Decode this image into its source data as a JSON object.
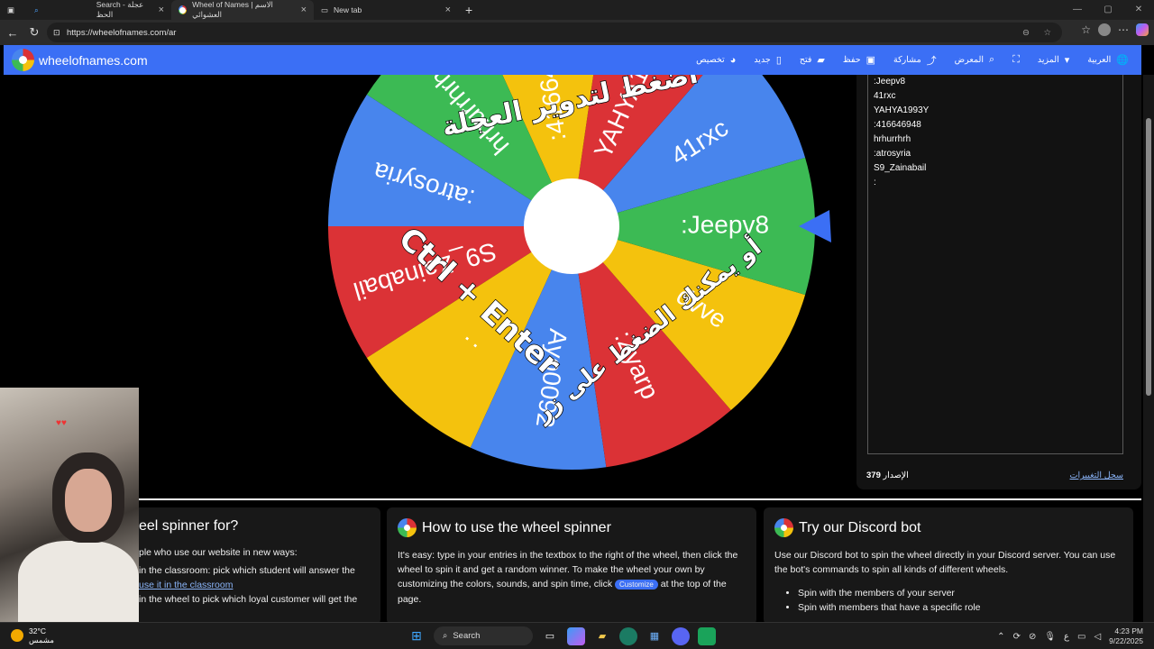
{
  "browser": {
    "tabs": [
      {
        "label": "Search - عجلة الحظ"
      },
      {
        "label": "Wheel of Names | الاسم العشوائي"
      },
      {
        "label": "New tab"
      }
    ],
    "url": "https://wheelofnames.com/ar"
  },
  "site": {
    "brand": "wheelofnames.com",
    "menu": [
      "العربية",
      "المزيد",
      "المعرض",
      "مشاركة",
      "حفظ",
      "فتح",
      "جديد",
      "تخصيص"
    ],
    "colors": {
      "header": "#3b6ff5",
      "red": "#db3236",
      "yellow": "#f4c20d",
      "green": "#3cba54",
      "blue": "#4885ed"
    }
  },
  "wheel": {
    "segments": [
      "41rxc",
      "YAHYA1993Y",
      ":416646948",
      "hrhurrhrh",
      ":atrosyria",
      "S9_Zainabail",
      ":",
      "Ayo0092",
      ":Zyarp",
      "dvve",
      ":Jeepv8"
    ],
    "overlay_lines": [
      "اضغط لتدوير العجلة",
      "أو يمكنك الضغط على زر",
      "Ctrl + Enter"
    ]
  },
  "entries": {
    "items": [
      ":Jeepv8",
      "41rxc",
      "YAHYA1993Y",
      ":416646948",
      "hrhurrhrh",
      ":atrosyria",
      "S9_Zainabail",
      ":"
    ],
    "version_label": "الإصدار",
    "version": "379",
    "changelog": "سجل التغييرات"
  },
  "cards": {
    "card1": {
      "title": "eel spinner for?",
      "lines": [
        "ple who use our website in new ways:",
        "in the classroom: pick which student will answer the",
        "use it in the classroom",
        "in the wheel to pick which loyal customer will get the"
      ]
    },
    "card2": {
      "title": "How to use the wheel spinner",
      "text_before": "It's easy: type in your entries in the textbox to the right of the wheel, then click the wheel to spin it and get a random winner. To make the wheel your own by customizing the colors, sounds, and spin time, click",
      "button": "Customize",
      "text_after": "at the top of the page."
    },
    "card3": {
      "title": "Try our Discord bot",
      "text": "Use our Discord bot to spin the wheel directly in your Discord server. You can use the bot's commands to spin all kinds of different wheels.",
      "bullets": [
        "Spin with the members of your server",
        "Spin with members that have a specific role"
      ]
    }
  },
  "taskbar": {
    "temp": "32°C",
    "weather": "مشمس",
    "search": "Search",
    "time": "4:23 PM",
    "date": "9/22/2025",
    "lang": "ع"
  }
}
